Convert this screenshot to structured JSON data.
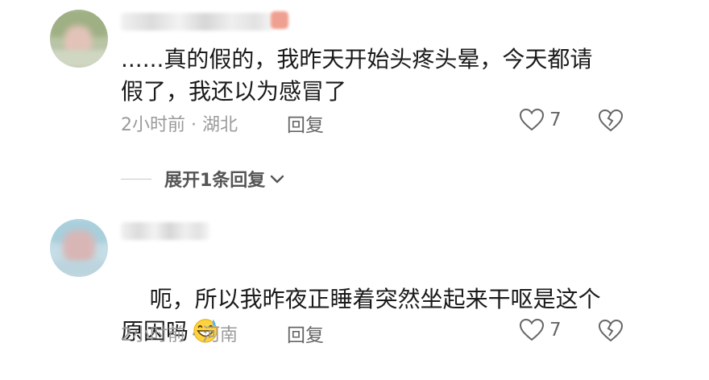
{
  "comments": [
    {
      "text": "......真的假的，我昨天开始头疼头晕，今天都请\n假了，我还以为感冒了",
      "time_location": "2小时前 · 湖北",
      "reply_label": "回复",
      "likes": "7"
    },
    {
      "text": "呃，所以我昨夜正睡着突然坐起来干呕是这个\n原因吗",
      "time_location": "2小时前 · 河南",
      "reply_label": "回复",
      "likes": "7"
    }
  ],
  "expand_replies": {
    "label": "展开1条回复"
  },
  "icons": {
    "like": "heart-outline-icon",
    "dislike": "broken-heart-icon",
    "expand": "chevron-down-icon",
    "emoji": "grinning-sweat-emoji-icon"
  },
  "colors": {
    "text": "#1a1a1a",
    "meta": "#9a9a9a",
    "icon": "#666666"
  }
}
